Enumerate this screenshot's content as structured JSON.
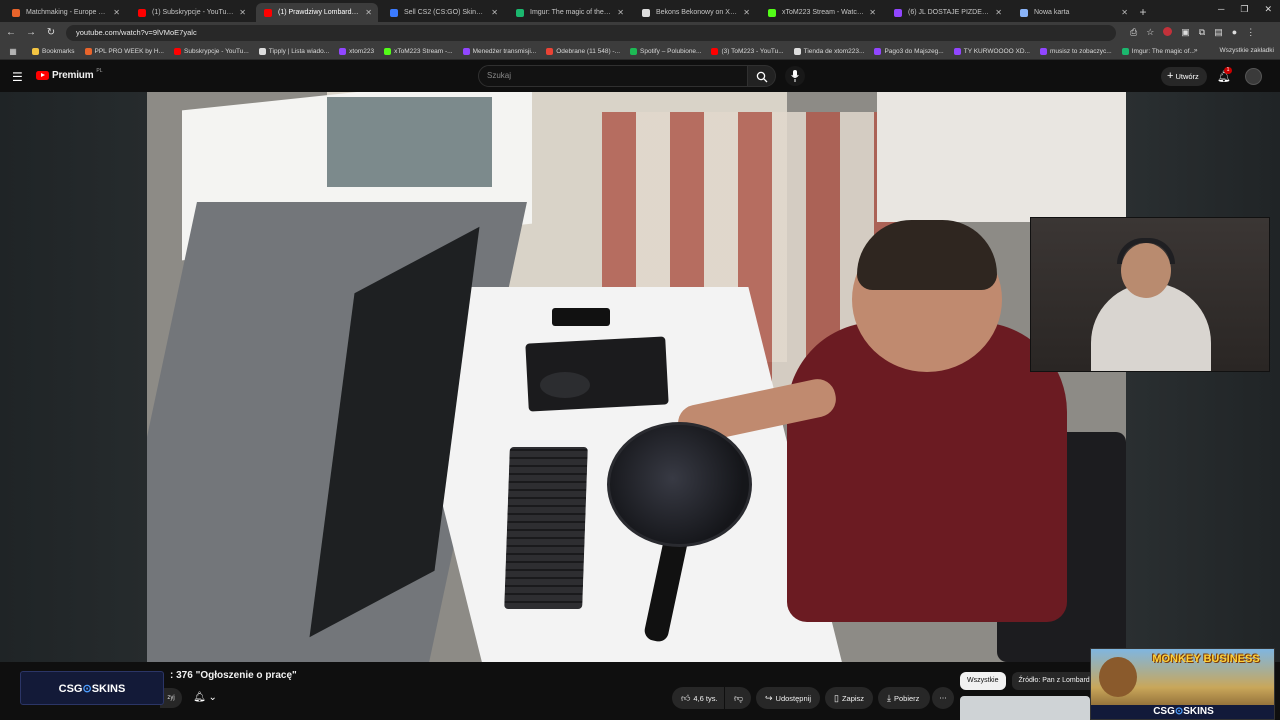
{
  "browser": {
    "tabs": [
      {
        "label": "Matchmaking - Europe 5v5 Qu",
        "color": "#e8642b"
      },
      {
        "label": "(1) Subskrypcje - YouTube",
        "color": "#ff0000"
      },
      {
        "label": "(1) Prawdziwy Lombard - O",
        "color": "#ff0000",
        "active": true
      },
      {
        "label": "Sell CS2 (CS:GO) Skins | Best C",
        "color": "#3b7bff"
      },
      {
        "label": "Imgur: The magic of the Intern",
        "color": "#1bb76e"
      },
      {
        "label": "Bekons Bekonowy on X: \"Karto",
        "color": "#dddddd"
      },
      {
        "label": "xToM223 Stream - Watch Live",
        "color": "#53fc18"
      },
      {
        "label": "(6) JL DOSTAJE PIZDEE - Twitch",
        "color": "#9146ff"
      },
      {
        "label": "Nowa karta",
        "color": "#8ab4f8"
      }
    ],
    "url": "youtube.com/watch?v=9lVMoE7yalc",
    "bookmarks": [
      {
        "label": "Bookmarks",
        "color": "#f4c542"
      },
      {
        "label": "PPL PRO WEEK by H...",
        "color": "#e8642b"
      },
      {
        "label": "Subskrypcje - YouTu...",
        "color": "#ff0000"
      },
      {
        "label": "Tipply | Lista wiado...",
        "color": "#dddddd"
      },
      {
        "label": "xtom223",
        "color": "#9146ff"
      },
      {
        "label": "xToM223 Stream -...",
        "color": "#53fc18"
      },
      {
        "label": "Menedżer transmisji...",
        "color": "#9146ff"
      },
      {
        "label": "Odebrane (11 548) -...",
        "color": "#ea4335"
      },
      {
        "label": "Spotify – Polubione...",
        "color": "#1db954"
      },
      {
        "label": "(3) ToM223 - YouTu...",
        "color": "#ff0000"
      },
      {
        "label": "Tienda de xtom223...",
        "color": "#dddddd"
      },
      {
        "label": "Pago3 do Majszeg...",
        "color": "#9146ff"
      },
      {
        "label": "TY KURWOOOO XD...",
        "color": "#9146ff"
      },
      {
        "label": "musisz to zobaczyc...",
        "color": "#9146ff"
      },
      {
        "label": "Imgur: The magic of...",
        "color": "#1bb76e"
      }
    ],
    "bookmarks_more": "»",
    "all_bookmarks": "Wszystkie zakładki"
  },
  "youtube": {
    "logo_word": "Premium",
    "logo_region": "PL",
    "search_placeholder": "Szukaj",
    "create_label": "Utwórz",
    "notif_count": "1",
    "video_title": ": 376 \"Ogłoszenie o pracę\"",
    "subscribed_fragment": "zyj",
    "like_count": "4,6 tys.",
    "share_label": "Udostępnij",
    "save_label": "Zapisz",
    "download_label": "Pobierz",
    "chips": [
      "Wszystkie",
      "Źródło: Pan z Lombardu"
    ]
  },
  "overlays": {
    "csg_pre": "CSG",
    "csg_o": "⊙",
    "csg_post": "SKINS",
    "game_title": "MONKEY BUSINESS"
  }
}
